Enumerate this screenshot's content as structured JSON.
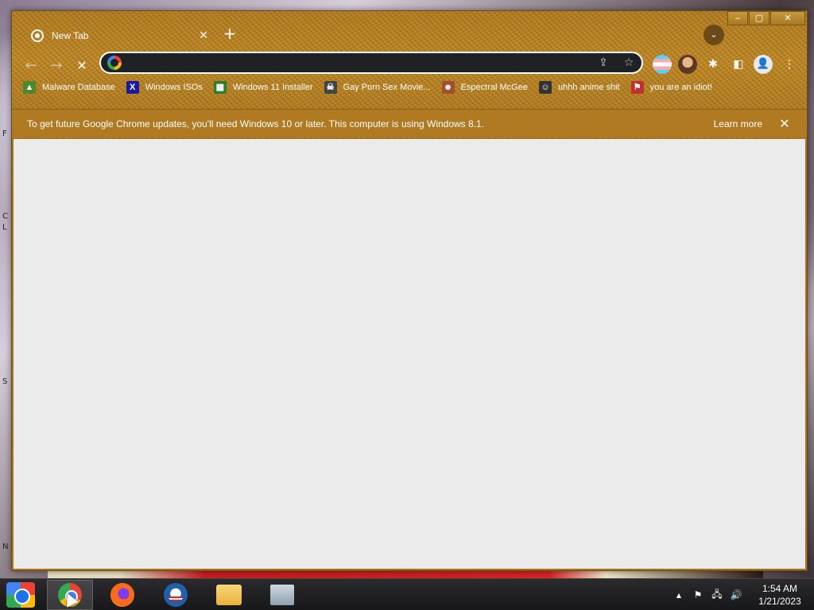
{
  "desktop": {
    "left_edge_letters": [
      "F",
      "C",
      "L",
      "S",
      "N"
    ]
  },
  "window": {
    "tab": {
      "title": "New Tab",
      "close_glyph": "✕"
    },
    "new_tab_glyph": "+",
    "tab_search_glyph": "⌄",
    "controls": {
      "minimize": "‒",
      "maximize": "▢",
      "close": "✕"
    }
  },
  "toolbar": {
    "back_glyph": "←",
    "forward_glyph": "→",
    "stop_glyph": "✕",
    "omnibox": {
      "value": "",
      "placeholder": ""
    },
    "share_glyph": "⇪",
    "bookmark_star_glyph": "☆",
    "extensions_glyph": "✱",
    "side_panel_glyph": "◧",
    "profile_glyph": "👤",
    "menu_glyph": "⋮"
  },
  "bookmarks": [
    {
      "label": "Malware Database",
      "icon": "malware-icon",
      "glyph": "▲",
      "color": "#4a8a2a"
    },
    {
      "label": "Windows ISOs",
      "icon": "x-icon",
      "glyph": "X",
      "color": "#1a1aa0"
    },
    {
      "label": "Windows 11 Installer",
      "icon": "installer-icon",
      "glyph": "▦",
      "color": "#2d7d2d"
    },
    {
      "label": "Gay Porn Sex Movie...",
      "icon": "skull-icon",
      "glyph": "☠",
      "color": "#444444"
    },
    {
      "label": "Espectral McGee",
      "icon": "face-icon",
      "glyph": "☻",
      "color": "#a05030"
    },
    {
      "label": "uhhh anime shit",
      "icon": "anime-icon",
      "glyph": "☺",
      "color": "#333333"
    },
    {
      "label": "you are an idiot!",
      "icon": "flag-icon",
      "glyph": "⚑",
      "color": "#c03030"
    }
  ],
  "infobar": {
    "message": "To get future Google Chrome updates, you'll need Windows 10 or later. This computer is using Windows 8.1.",
    "learn_more": "Learn more",
    "close_glyph": "✕"
  },
  "taskbar": {
    "apps": [
      {
        "name": "chrome",
        "active": true
      },
      {
        "name": "firefox",
        "active": false
      },
      {
        "name": "obama",
        "active": false
      },
      {
        "name": "file-explorer",
        "active": false
      },
      {
        "name": "monitor",
        "active": false
      }
    ],
    "tray": {
      "show_hidden_glyph": "▲",
      "flag_glyph": "⚑",
      "network_glyph": "🖧",
      "volume_glyph": "🔊"
    },
    "time": "1:54 AM",
    "date": "1/21/2023"
  },
  "colors": {
    "frame": "#b98426",
    "infobar": "#b07a22",
    "content": "#ebebeb",
    "omnibox": "#202124"
  }
}
